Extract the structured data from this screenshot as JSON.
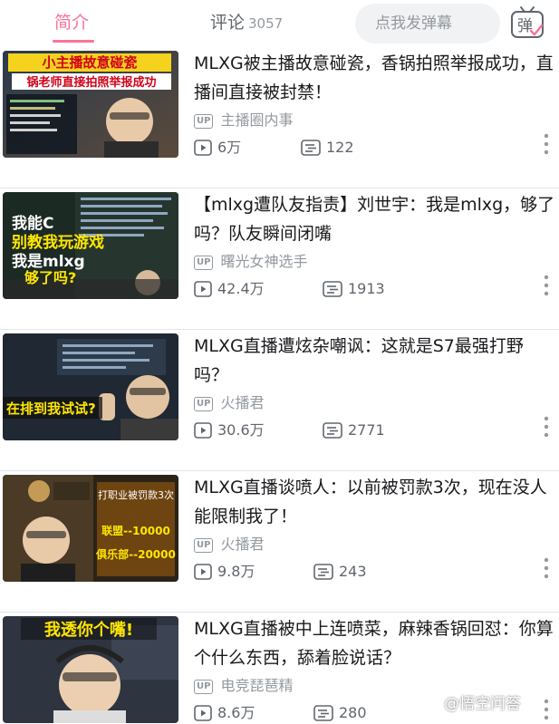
{
  "tabs": {
    "intro": "简介",
    "comments": "评论",
    "comments_count": "3057"
  },
  "danmaku": {
    "placeholder": "点我发弹幕",
    "toggle_label": "弹"
  },
  "up_badge": "UP",
  "videos": [
    {
      "title": "MLXG被主播故意碰瓷，香锅拍照举报成功，直播间直接被封禁！",
      "uploader": "主播圈内事",
      "views": "6万",
      "danmaku_count": "122",
      "thumb_caption_1": "小主播故意碰瓷",
      "thumb_caption_2": "锅老师直接拍照举报成功"
    },
    {
      "title": "【mlxg遭队友指责】刘世宇：我是mlxg，够了吗？队友瞬间闭嘴",
      "uploader": "曙光女神选手",
      "views": "42.4万",
      "danmaku_count": "1913",
      "thumb_caption_1": "我能C",
      "thumb_caption_2": "别教我玩游戏",
      "thumb_caption_3": "我是mlxg",
      "thumb_caption_4": "够了吗?"
    },
    {
      "title": "MLXG直播遭炫杂嘲讽：这就是S7最强打野吗？",
      "uploader": "火播君",
      "views": "30.6万",
      "danmaku_count": "2771",
      "thumb_caption_1": "在排到我试试?"
    },
    {
      "title": "MLXG直播谈喷人：以前被罚款3次，现在没人能限制我了！",
      "uploader": "火播君",
      "views": "9.8万",
      "danmaku_count": "243",
      "thumb_caption_1": "打职业被罚款3次",
      "thumb_caption_2": "联盟--10000",
      "thumb_caption_3": "俱乐部--20000"
    },
    {
      "title": "MLXG直播被中上连喷菜，麻辣香锅回怼：你算个什么东西，舔着脸说话？",
      "uploader": "电竞琵琶精",
      "views": "8.6万",
      "danmaku_count": "280",
      "thumb_caption_1": "我透你个嘴!"
    }
  ],
  "watermark": "@悟空问答",
  "colors": {
    "accent": "#fb7299",
    "text": "#18191c",
    "muted": "#9499a0",
    "divider": "#e3e5e7"
  }
}
